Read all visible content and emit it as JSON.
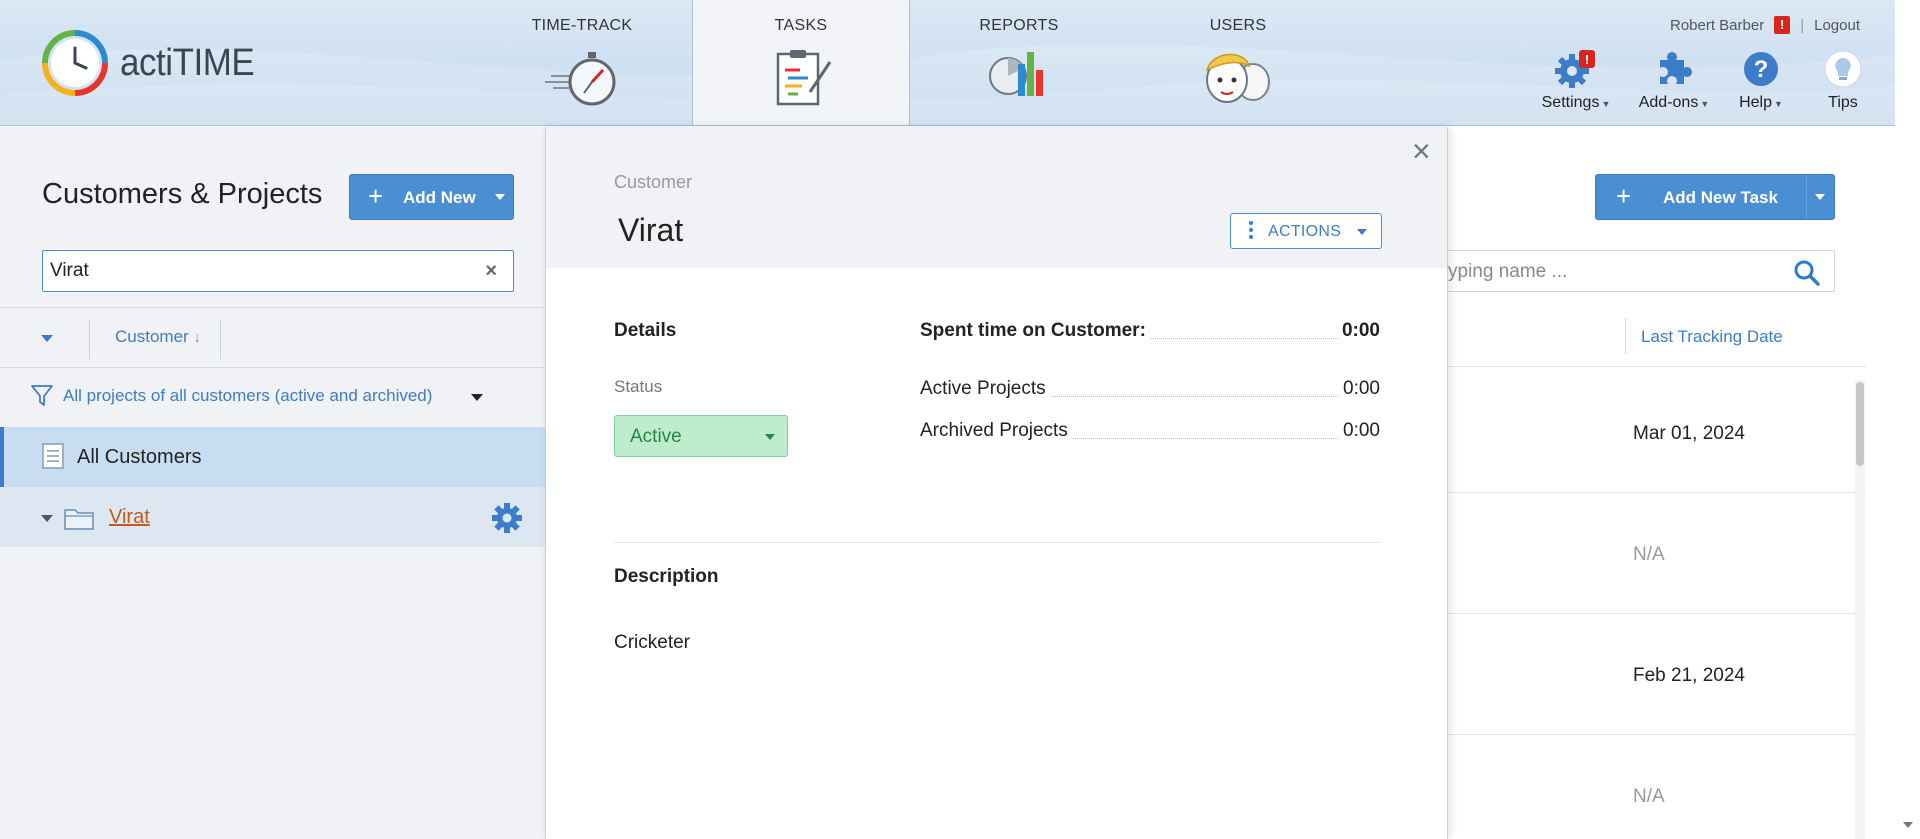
{
  "app": {
    "logo_text": "actiTIME"
  },
  "nav": {
    "tabs": [
      {
        "label": "TIME-TRACK",
        "icon": "stopwatch-icon",
        "active": false
      },
      {
        "label": "TASKS",
        "icon": "clipboard-tasks-icon",
        "active": true
      },
      {
        "label": "REPORTS",
        "icon": "reports-chart-icon",
        "active": false
      },
      {
        "label": "USERS",
        "icon": "users-faces-icon",
        "active": false
      }
    ]
  },
  "user": {
    "name": "Robert Barber",
    "alert": "!",
    "separator": "|",
    "logout": "Logout"
  },
  "tools": {
    "settings": {
      "label": "Settings",
      "icon": "gear-icon",
      "badge": "!"
    },
    "addons": {
      "label": "Add-ons",
      "icon": "puzzle-icon"
    },
    "help": {
      "label": "Help",
      "icon": "help-icon",
      "mark": "?"
    },
    "tips": {
      "label": "Tips",
      "icon": "lightbulb-icon"
    }
  },
  "left": {
    "title": "Customers & Projects",
    "add_new": {
      "plus": "+",
      "label": "Add New"
    },
    "search": {
      "value": "Virat",
      "clear": "×"
    },
    "sort": {
      "column": "Customer",
      "arrow": "↓"
    },
    "filter": {
      "label": "All projects of all customers (active and archived)"
    },
    "tree": {
      "all_customers": "All Customers",
      "customers": [
        {
          "name": "Virat"
        }
      ]
    }
  },
  "modal": {
    "close": "×",
    "type": "Customer",
    "name": "Virat",
    "actions": "ACTIONS",
    "details_heading": "Details",
    "status_label": "Status",
    "status_value": "Active",
    "spent": {
      "label": "Spent time on Customer:",
      "value": "0:00"
    },
    "rows": [
      {
        "label": "Active Projects",
        "value": "0:00"
      },
      {
        "label": "Archived Projects",
        "value": "0:00"
      }
    ],
    "description_heading": "Description",
    "description": "Cricketer"
  },
  "right": {
    "add_task": {
      "plus": "+",
      "label": "Add New Task"
    },
    "search_placeholder": "yping name ...",
    "column": "Last Tracking Date",
    "rows": [
      "Mar 01, 2024",
      "N/A",
      "Feb 21, 2024",
      "N/A"
    ]
  },
  "colors": {
    "accent": "#4b8fd3",
    "link": "#3d7cc9",
    "active_status": "#bfeccd",
    "customer_link": "#c4591d"
  }
}
